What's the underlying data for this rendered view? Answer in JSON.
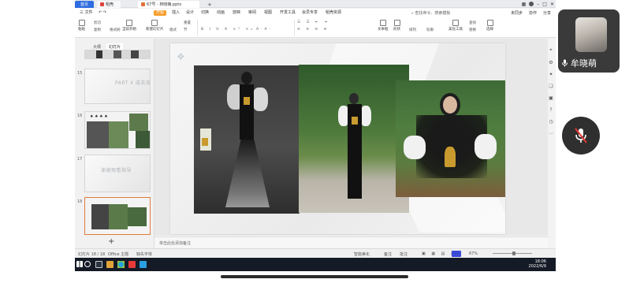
{
  "meeting": {
    "participant": {
      "name": "牟晓萌"
    }
  },
  "app": {
    "tabs": {
      "home": "首页",
      "daoke": "稻壳",
      "file": "67号 - 林晓萌.pptx",
      "add": "+"
    },
    "menu": [
      {
        "label": "三 文件"
      },
      {
        "label": "开始",
        "active": true
      },
      {
        "label": "插入"
      },
      {
        "label": "设计"
      },
      {
        "label": "切换"
      },
      {
        "label": "动画"
      },
      {
        "label": "放映"
      },
      {
        "label": "审阅"
      },
      {
        "label": "视图"
      },
      {
        "label": "开发工具"
      },
      {
        "label": "会员专享"
      },
      {
        "label": "稻壳资源"
      }
    ],
    "search_label": "查找命令、搜索模板",
    "menu_right": [
      "未同步",
      "协作",
      "分享"
    ],
    "ribbon": {
      "paste": "粘贴",
      "cut": "剪切",
      "copy": "复制",
      "format_painter": "格式刷",
      "start_play": "当前开始",
      "new_slide": "新建幻灯片",
      "layout": "版式",
      "section": "节",
      "reset": "重置",
      "textbox": "文本框",
      "shape": "形状",
      "arrange": "排列",
      "outline": "轮廓",
      "beauty_tool": "美化工具",
      "find": "查找",
      "replace": "替换",
      "select": "选择"
    },
    "panel": {
      "tabs": [
        "大纲",
        "幻灯片"
      ],
      "slides": [
        {
          "no": "15",
          "text": "PART 4  成衣效果"
        },
        {
          "no": "16",
          "text": ""
        },
        {
          "no": "17",
          "text": "谢谢观看指导"
        },
        {
          "no": "18",
          "text": ""
        }
      ],
      "add": "+"
    },
    "notes_placeholder": "单击此处添加备注",
    "status": {
      "slide_count": "幻灯片 18 / 18",
      "theme": "Office 主题",
      "font_missing": "缺失字体",
      "smart_beautify": "智能美化",
      "notes": "备注",
      "comments": "批注",
      "zoom": "67%"
    },
    "taskbar": {
      "time": "18:06",
      "date": "2022/6/9"
    }
  },
  "colors": {
    "accent_orange": "#f59e2b",
    "active_thumb_border": "#e37a3c",
    "home_tab_blue": "#2f6ce0",
    "taskbar": "#141a26"
  }
}
